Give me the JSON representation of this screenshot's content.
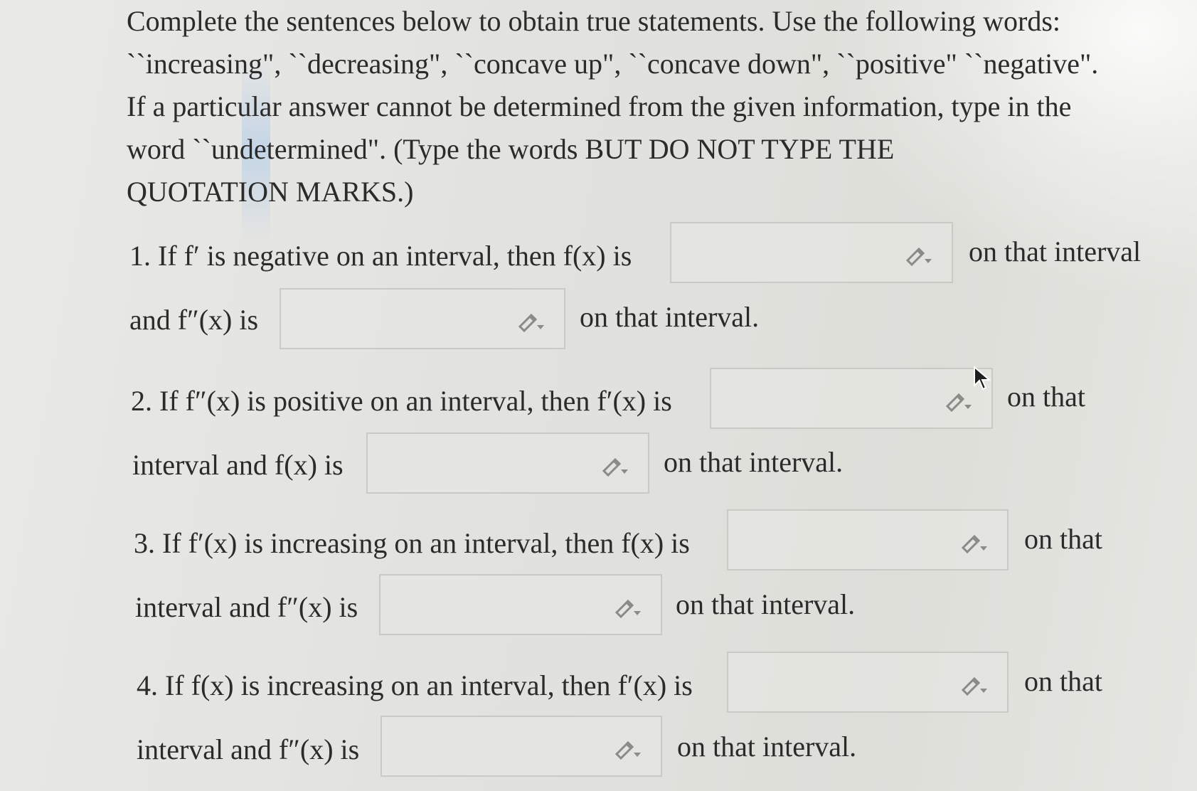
{
  "intro": {
    "line1": "Complete the sentences below to obtain true statements. Use the following words:",
    "line2": "``increasing\", ``decreasing\", ``concave up\", ``concave down\", ``positive\" ``negative\".",
    "line3": "If a particular answer cannot be determined from the given information, type in the",
    "line4": "word ``undetermined\". (Type the words BUT DO NOT TYPE THE",
    "line5": "QUOTATION MARKS.)"
  },
  "questions": [
    {
      "line1_prefix": "1. If f′ is negative on an interval, then f(x) is",
      "line1_suffix": "on that interval",
      "line2_prefix": "and f″(x) is",
      "line2_suffix": "on that interval.",
      "answer1": "",
      "answer2": ""
    },
    {
      "line1_prefix": "2. If f″(x) is positive on an interval, then f′(x) is",
      "line1_suffix": "on that",
      "line2_prefix": "interval and f(x) is",
      "line2_suffix": "on that interval.",
      "answer1": "",
      "answer2": ""
    },
    {
      "line1_prefix": "3. If f′(x) is increasing on an interval, then f(x) is",
      "line1_suffix": "on that",
      "line2_prefix": "interval and f″(x) is",
      "line2_suffix": "on that interval.",
      "answer1": "",
      "answer2": ""
    },
    {
      "line1_prefix": "4. If f(x) is increasing on an interval, then f′(x) is",
      "line1_suffix": "on that",
      "line2_prefix": "interval and f″(x) is",
      "line2_suffix": "on that interval.",
      "answer1": "",
      "answer2": ""
    }
  ],
  "icons": {
    "answer_box_icon": "pencil-dropdown-icon",
    "pointer": "mouse-cursor-icon"
  },
  "colors": {
    "text": "#2b2b2b",
    "box_border": "#c9c9c5",
    "icon": "#8a8a88"
  }
}
